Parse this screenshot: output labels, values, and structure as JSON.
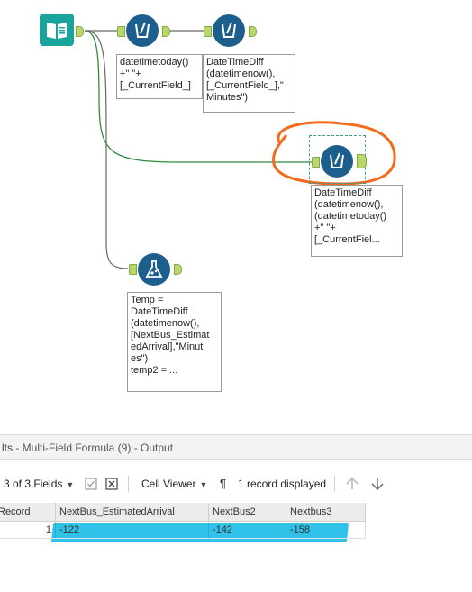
{
  "canvas": {
    "annotations": {
      "formula_tool_1": "datetimetoday()\n+\" \"+\n[_CurrentField_]",
      "formula_tool_2": "DateTimeDiff\n(datetimenow(),\n[_CurrentField_],\"\nMinutes\")",
      "formula_tool_3": "DateTimeDiff\n(datetimenow(),\n(datetimetoday()\n+\" \"+\n[_CurrentFiel...",
      "formula_tool_4": "Temp =\nDateTimeDiff\n(datetimenow(),\n[NextBus_Estimat\nedArrival],\"Minut\nes\")\ntemp2 = ..."
    },
    "highlight_color": "#f26a1b",
    "wire_color": "#2f8a3c"
  },
  "results": {
    "title_lead": "lts",
    "title_rest": " - Multi-Field Formula (9) - Output",
    "fields_selector": "3 of 3 Fields",
    "cell_viewer": "Cell Viewer",
    "record_count": "1 record displayed",
    "columns": [
      "Record",
      "NextBus_EstimatedArrival",
      "NextBus2",
      "Nextbus3"
    ],
    "rows": [
      [
        "1",
        "-122",
        "-142",
        "-158"
      ]
    ]
  },
  "icons": {
    "input": "book-input-icon",
    "formula": "formula-tool-icon",
    "flask": "flask-tool-icon",
    "checkbox": "checkbox-icon",
    "delete": "delete-icon",
    "pilcrow": "pilcrow-icon",
    "up": "arrow-up-icon",
    "down": "arrow-down-icon"
  }
}
